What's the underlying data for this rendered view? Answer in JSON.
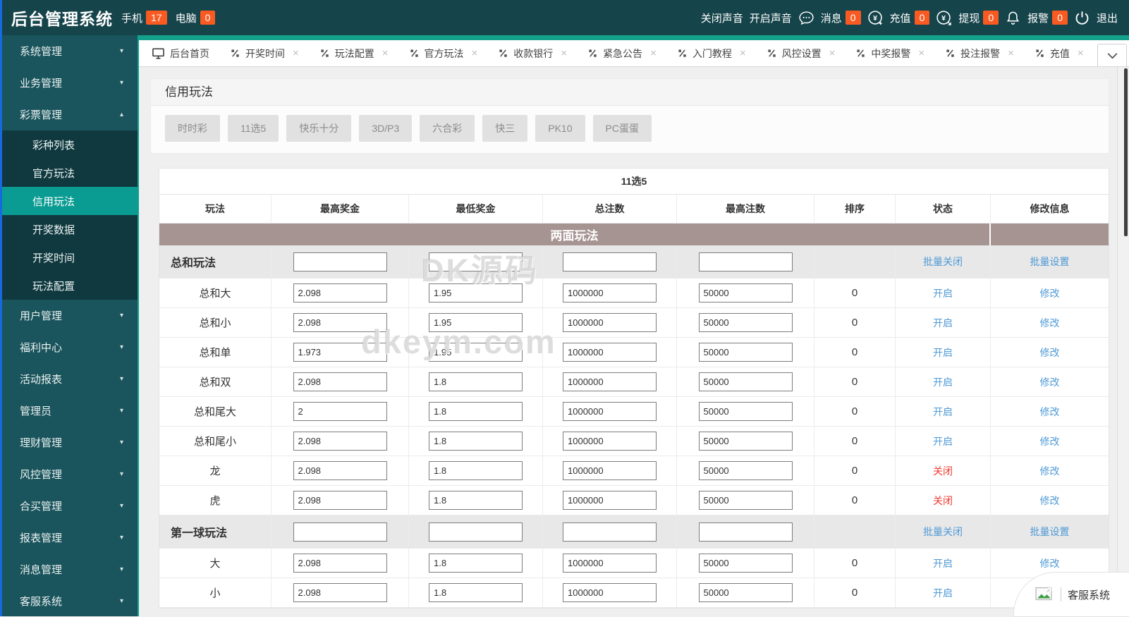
{
  "header": {
    "title": "后台管理系统",
    "mobile_label": "手机",
    "mobile_count": "17",
    "pc_label": "电脑",
    "pc_count": "0",
    "sound_off_label": "关闭声音",
    "sound_on_label": "开启声音",
    "stats": [
      {
        "label": "消息",
        "count": "0",
        "icon": "chat-icon"
      },
      {
        "label": "充值",
        "count": "0",
        "icon": "yuan-plus-icon"
      },
      {
        "label": "提现",
        "count": "0",
        "icon": "yuan-out-icon"
      },
      {
        "label": "报警",
        "count": "0",
        "icon": "bell-icon"
      }
    ],
    "logout_label": "退出"
  },
  "tabs": {
    "home": "后台首页",
    "items": [
      "开奖时间",
      "玩法配置",
      "官方玩法",
      "收款银行",
      "紧急公告",
      "入门教程",
      "风控设置",
      "中奖报警",
      "投注报警",
      "充值"
    ]
  },
  "sidebar": {
    "items": [
      {
        "label": "系统管理",
        "type": "parent"
      },
      {
        "label": "业务管理",
        "type": "parent"
      },
      {
        "label": "彩票管理",
        "type": "parent-open"
      },
      {
        "label": "彩种列表",
        "type": "sub"
      },
      {
        "label": "官方玩法",
        "type": "sub"
      },
      {
        "label": "信用玩法",
        "type": "sub-active"
      },
      {
        "label": "开奖数据",
        "type": "sub"
      },
      {
        "label": "开奖时间",
        "type": "sub"
      },
      {
        "label": "玩法配置",
        "type": "sub"
      },
      {
        "label": "用户管理",
        "type": "parent"
      },
      {
        "label": "福利中心",
        "type": "parent"
      },
      {
        "label": "活动报表",
        "type": "parent"
      },
      {
        "label": "管理员",
        "type": "parent"
      },
      {
        "label": "理财管理",
        "type": "parent"
      },
      {
        "label": "风控管理",
        "type": "parent"
      },
      {
        "label": "合买管理",
        "type": "parent"
      },
      {
        "label": "报表管理",
        "type": "parent"
      },
      {
        "label": "消息管理",
        "type": "parent"
      },
      {
        "label": "客服系统",
        "type": "parent"
      }
    ]
  },
  "panel": {
    "title": "信用玩法",
    "games": [
      "时时彩",
      "11选5",
      "快乐十分",
      "3D/P3",
      "六合彩",
      "快三",
      "PK10",
      "PC蛋蛋"
    ]
  },
  "table": {
    "title": "11选5",
    "columns": [
      "玩法",
      "最高奖金",
      "最低奖金",
      "总注数",
      "最高注数",
      "排序",
      "状态",
      "修改信息"
    ],
    "section": "两面玩法",
    "batch_close_label": "批量关闭",
    "batch_set_label": "批量设置",
    "modify_label": "修改",
    "status_open_label": "开启",
    "status_closed_label": "关闭",
    "groups": [
      {
        "name": "总和玩法",
        "rows": [
          {
            "name": "总和大",
            "max": "2.098",
            "min": "1.95",
            "total": "1000000",
            "maxbet": "50000",
            "sort": "0",
            "state": "open"
          },
          {
            "name": "总和小",
            "max": "2.098",
            "min": "1.95",
            "total": "1000000",
            "maxbet": "50000",
            "sort": "0",
            "state": "open"
          },
          {
            "name": "总和单",
            "max": "1.973",
            "min": "1.95",
            "total": "1000000",
            "maxbet": "50000",
            "sort": "0",
            "state": "open"
          },
          {
            "name": "总和双",
            "max": "2.098",
            "min": "1.8",
            "total": "1000000",
            "maxbet": "50000",
            "sort": "0",
            "state": "open"
          },
          {
            "name": "总和尾大",
            "max": "2",
            "min": "1.8",
            "total": "1000000",
            "maxbet": "50000",
            "sort": "0",
            "state": "open"
          },
          {
            "name": "总和尾小",
            "max": "2.098",
            "min": "1.8",
            "total": "1000000",
            "maxbet": "50000",
            "sort": "0",
            "state": "open"
          },
          {
            "name": "龙",
            "max": "2.098",
            "min": "1.8",
            "total": "1000000",
            "maxbet": "50000",
            "sort": "0",
            "state": "closed"
          },
          {
            "name": "虎",
            "max": "2.098",
            "min": "1.8",
            "total": "1000000",
            "maxbet": "50000",
            "sort": "0",
            "state": "closed"
          }
        ]
      },
      {
        "name": "第一球玩法",
        "rows": [
          {
            "name": "大",
            "max": "2.098",
            "min": "1.8",
            "total": "1000000",
            "maxbet": "50000",
            "sort": "0",
            "state": "open"
          },
          {
            "name": "小",
            "max": "2.098",
            "min": "1.8",
            "total": "1000000",
            "maxbet": "50000",
            "sort": "0",
            "state": "open"
          }
        ]
      }
    ]
  },
  "watermarks": {
    "wm1": "DK源码",
    "wm2": "dkeym.com"
  },
  "service": {
    "label": "客服系统"
  },
  "colors": {
    "accent_teal": "#14a18c",
    "header_teal": "#16444b",
    "sidebar_teal": "#1a545c",
    "submenu_teal": "#10393f",
    "active_teal": "#0a9c92",
    "badge_orange": "#f95a22",
    "link_blue": "#4f9ad6",
    "status_red": "#f0382e",
    "band_mauve": "#a69492",
    "edge_blue": "#1769e0"
  }
}
